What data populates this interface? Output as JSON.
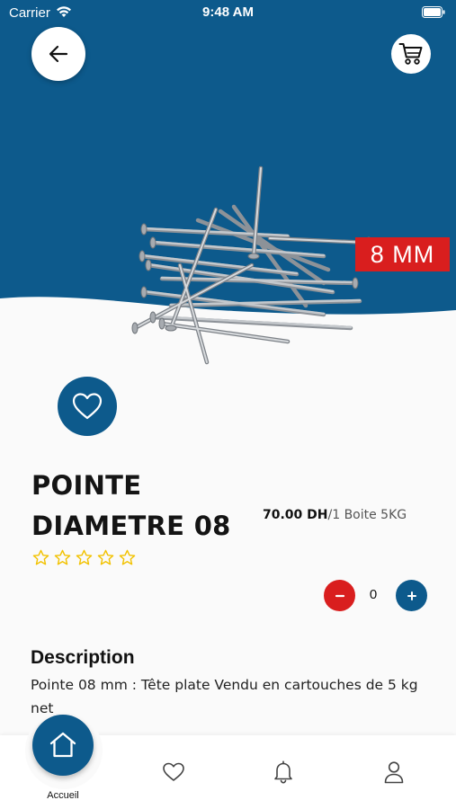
{
  "status_bar": {
    "carrier": "Carrier",
    "time": "9:48 AM"
  },
  "colors": {
    "primary": "#0d5a8c",
    "accent_red": "#d91e1e",
    "star": "#f2c200",
    "background": "#fafafa"
  },
  "header": {
    "back_icon": "arrow-left-icon",
    "cart_icon": "cart-icon"
  },
  "product": {
    "size_badge": "8 MM",
    "title_line1": "POINTE",
    "title_line2": "DIAMETRE 08",
    "price": "70.00 DH",
    "unit": "/1 Boite 5KG",
    "rating": 0,
    "rating_max": 5,
    "quantity": "0",
    "favorite_icon": "heart-icon"
  },
  "description": {
    "heading": "Description",
    "text": "Pointe 08 mm : Tête plate Vendu en cartouches de 5 kg net"
  },
  "bottom_nav": {
    "items": [
      {
        "label": "Accueil",
        "icon": "home-icon",
        "active": true
      },
      {
        "label": "",
        "icon": "heart-icon",
        "active": false
      },
      {
        "label": "",
        "icon": "bell-icon",
        "active": false
      },
      {
        "label": "",
        "icon": "user-icon",
        "active": false
      }
    ]
  }
}
